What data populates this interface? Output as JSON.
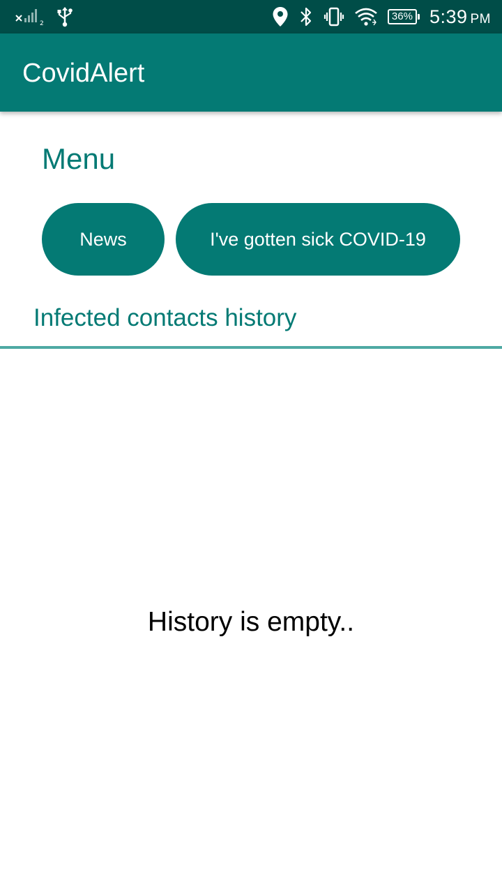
{
  "status_bar": {
    "signal_sim_label": "2",
    "battery_percent": "36%",
    "time": "5:39",
    "ampm": "PM",
    "icons": [
      "signal-x-icon",
      "usb-icon",
      "location-icon",
      "bluetooth-icon",
      "vibrate-icon",
      "wifi-icon",
      "battery-icon"
    ]
  },
  "app_bar": {
    "title": "CovidAlert"
  },
  "menu": {
    "title": "Menu",
    "news_button": "News",
    "sick_button": "I've gotten sick COVID-19"
  },
  "history": {
    "title": "Infected contacts history",
    "empty_text": "History is empty.."
  },
  "colors": {
    "primary": "#047a74",
    "status_bar": "#004d48",
    "divider": "#4ea9a3"
  }
}
